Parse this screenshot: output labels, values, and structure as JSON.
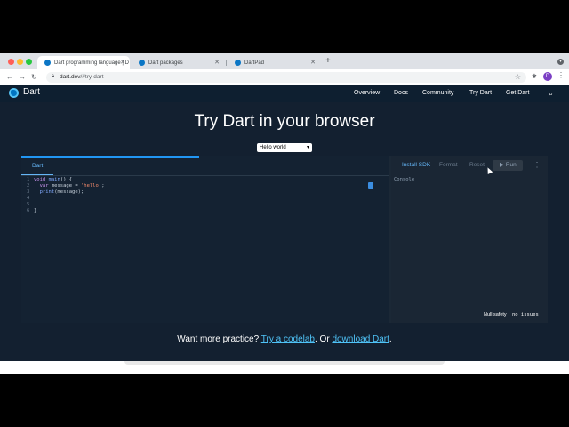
{
  "browser": {
    "tabs": [
      {
        "title": "Dart programming language | D",
        "active": true
      },
      {
        "title": "Dart packages",
        "active": false
      },
      {
        "title": "DartPad",
        "active": false
      }
    ],
    "url_host": "dart.dev",
    "url_path": "/#try-dart",
    "profile_initial": "D"
  },
  "header": {
    "brand": "Dart",
    "nav": [
      "Overview",
      "Docs",
      "Community",
      "Try Dart",
      "Get Dart"
    ]
  },
  "hero": {
    "title": "Try Dart in your browser",
    "sample_selected": "Hello world"
  },
  "pad": {
    "editor_tab": "Dart",
    "code_lines": [
      {
        "n": "1",
        "parts": [
          [
            "kw",
            "void "
          ],
          [
            "fn",
            "main"
          ],
          [
            "var",
            "() {"
          ]
        ]
      },
      {
        "n": "2",
        "parts": [
          [
            "kw",
            "  var "
          ],
          [
            "var",
            "message = "
          ],
          [
            "str",
            "'hello'"
          ],
          [
            "var",
            ";"
          ]
        ]
      },
      {
        "n": "3",
        "parts": [
          [
            "fn",
            "  print"
          ],
          [
            "var",
            "(message);"
          ]
        ]
      },
      {
        "n": "4",
        "parts": []
      },
      {
        "n": "5",
        "parts": []
      },
      {
        "n": "6",
        "parts": [
          [
            "var",
            "}"
          ]
        ]
      }
    ],
    "install_sdk": "Install SDK",
    "format": "Format",
    "reset": "Reset",
    "run": "Run",
    "console": "Console",
    "null_safety": "Null safety",
    "issues": "no issues"
  },
  "practice": {
    "prefix": "Want more practice? ",
    "link1": "Try a codelab",
    "middle": ". Or ",
    "link2": "download Dart",
    "suffix": "."
  },
  "colors": {
    "page_bg": "#132030",
    "accent": "#2196f3",
    "link": "#4fc3f7"
  }
}
